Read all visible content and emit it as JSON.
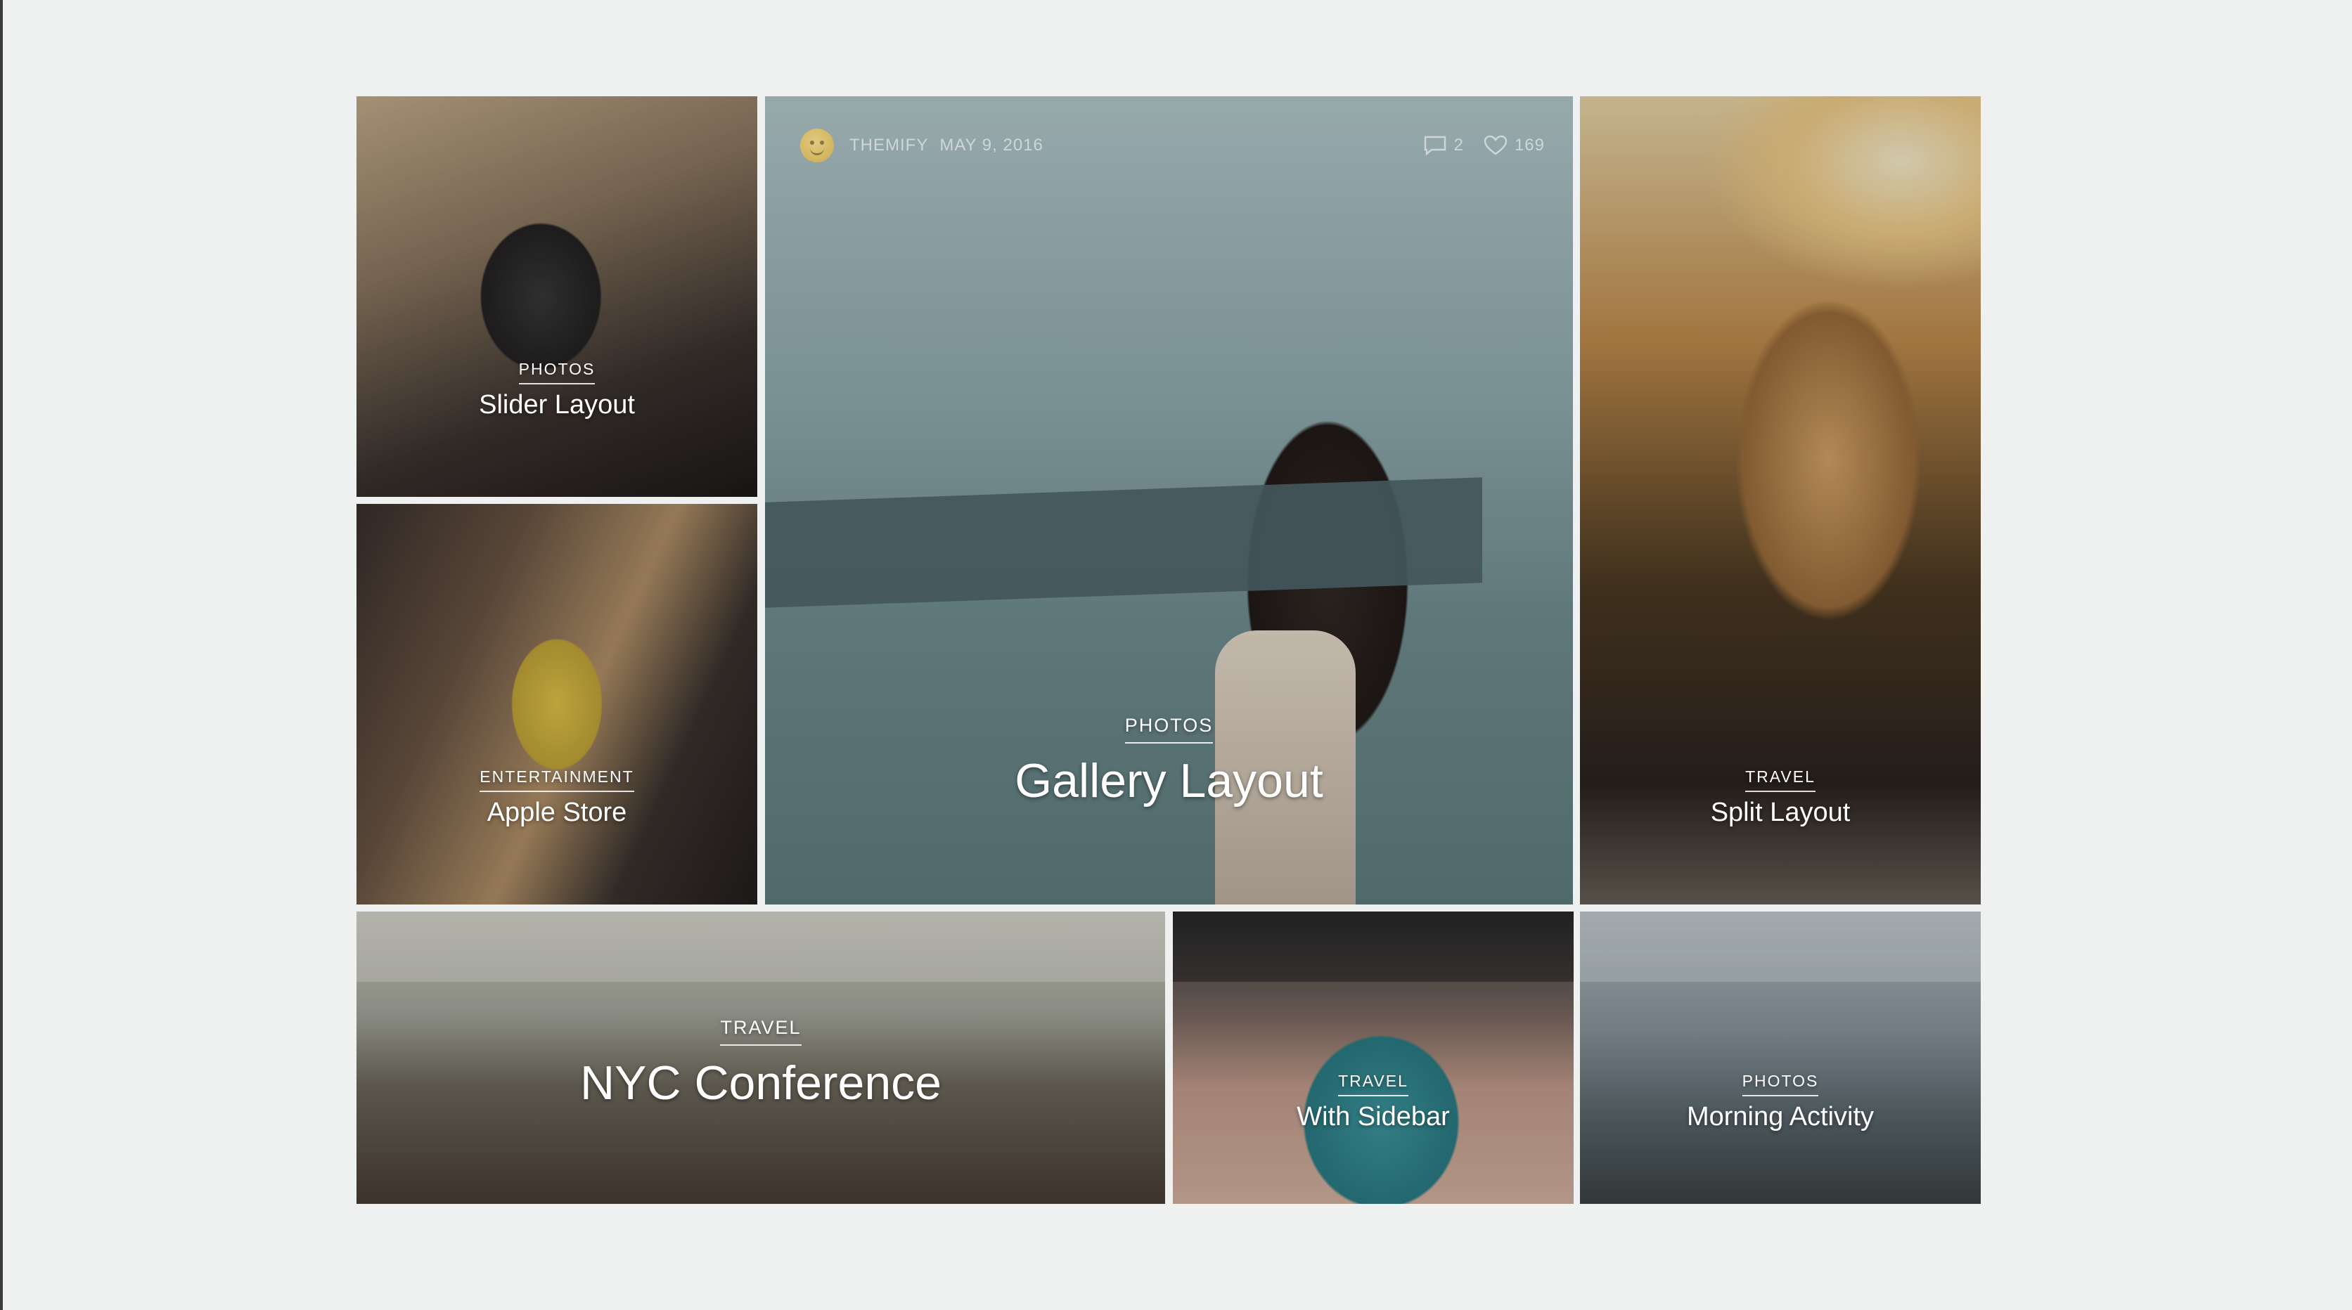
{
  "gallery_meta": {
    "author": "THEMIFY",
    "date": "MAY 9, 2016",
    "comments": "2",
    "likes": "169"
  },
  "tiles": [
    {
      "category": "PHOTOS",
      "title": "Slider Layout"
    },
    {
      "category": "ENTERTAINMENT",
      "title": "Apple Store"
    },
    {
      "category": "PHOTOS",
      "title": "Gallery Layout"
    },
    {
      "category": "TRAVEL",
      "title": "Split Layout"
    },
    {
      "category": "TRAVEL",
      "title": "NYC Conference"
    },
    {
      "category": "TRAVEL",
      "title": "With Sidebar"
    },
    {
      "category": "PHOTOS",
      "title": "Morning Activity"
    }
  ],
  "colors": {
    "page_background": "#eff0f0",
    "caption_text": "#ffffff"
  }
}
